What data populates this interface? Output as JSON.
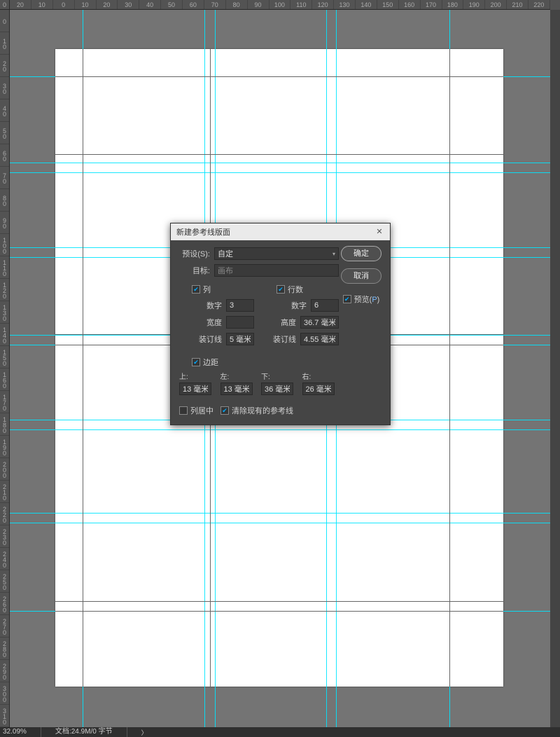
{
  "ruler_h": [
    "20",
    "10",
    "0",
    "10",
    "20",
    "30",
    "40",
    "50",
    "60",
    "70",
    "80",
    "90",
    "100",
    "110",
    "120",
    "130",
    "140",
    "150",
    "160",
    "170",
    "180",
    "190",
    "200",
    "210",
    "220"
  ],
  "ruler_v": [
    "0",
    "10",
    "20",
    "30",
    "40",
    "50",
    "60",
    "70",
    "80",
    "90",
    "100",
    "110",
    "120",
    "130",
    "140",
    "150",
    "160",
    "170",
    "180",
    "190",
    "200",
    "210",
    "220",
    "230",
    "240",
    "250",
    "260",
    "270",
    "280",
    "290",
    "300",
    "310"
  ],
  "ruler_origin": "0",
  "status": {
    "zoom": "32.09%",
    "doc": "文档:24.9M/0 字节",
    "chevron": "〉"
  },
  "dialog": {
    "title": "新建参考线版面",
    "preset_label": "预设(S):",
    "preset_value": "自定",
    "target_label": "目标:",
    "target_value": "画布",
    "columns": {
      "enabled_label": "列",
      "count_label": "数字",
      "count_value": "3",
      "width_label": "宽度",
      "width_value": "",
      "gutter_label": "装订线",
      "gutter_value": "5 毫米"
    },
    "rows": {
      "enabled_label": "行数",
      "count_label": "数字",
      "count_value": "6",
      "height_label": "高度",
      "height_value": "36.7 毫米",
      "gutter_label": "装订线",
      "gutter_value": "4.55 毫米"
    },
    "margin_label": "边距",
    "margins": {
      "top_label": "上:",
      "top_value": "13 毫米",
      "left_label": "左:",
      "left_value": "13 毫米",
      "bottom_label": "下:",
      "bottom_value": "36 毫米",
      "right_label": "右:",
      "right_value": "26 毫米"
    },
    "center_cols_label": "列居中",
    "clear_guides_label": "清除现有的参考线",
    "ok": "确定",
    "cancel": "取消",
    "preview_prefix": "预览(",
    "preview_hotkey": "P",
    "preview_suffix": ")"
  }
}
